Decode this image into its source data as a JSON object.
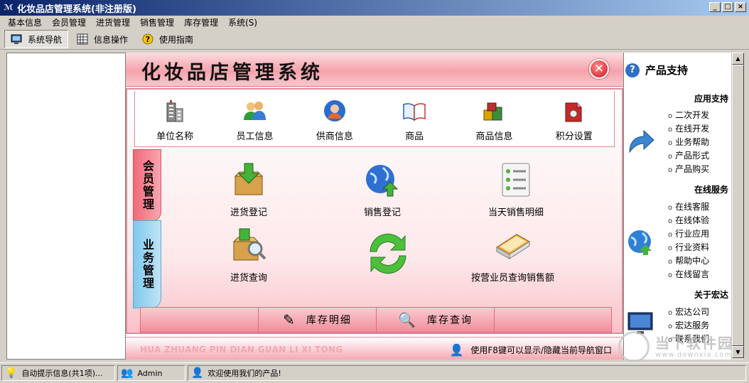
{
  "window": {
    "title": "化妆品店管理系统(非注册版)"
  },
  "menu": [
    "基本信息",
    "会员管理",
    "进货管理",
    "销售管理",
    "库存管理",
    "系统(S)"
  ],
  "toolbar": {
    "nav": "系统导航",
    "info": "信息操作",
    "guide": "使用指南"
  },
  "main": {
    "title": "化妆品店管理系统",
    "top_items": [
      "单位名称",
      "员工信息",
      "供商信息",
      "商品",
      "商品信息",
      "积分设置"
    ],
    "tabs": {
      "member": "会员管理",
      "business": "业务管理"
    },
    "actions": {
      "purchase_reg": "进货登记",
      "sales_reg": "销售登记",
      "daily_sales": "当天销售明细",
      "purchase_query": "进货查询",
      "clerk_sales": "按营业员查询销售额"
    },
    "bottom": {
      "stock_detail": "库存明细",
      "stock_query": "库存查询"
    },
    "footer_pinyin": "HUA ZHUANG PIN DIAN GUAN LI XI TONG",
    "footer_hint": "使用F8键可以显示/隐藏当前导航窗口"
  },
  "right": {
    "title": "产品支持",
    "sec1": "应用支持",
    "sec1_items": [
      "二次开发",
      "在线开发",
      "业务帮助",
      "产品形式",
      "产品购买"
    ],
    "sec2": "在线服务",
    "sec2_items": [
      "在线客服",
      "在线体验",
      "行业应用",
      "行业资料",
      "帮助中心",
      "在线留言"
    ],
    "sec3": "关于宏达",
    "sec3_items": [
      "宏达公司",
      "宏达服务",
      "联系我们"
    ]
  },
  "status": {
    "tips": "自动提示信息(共1项)...",
    "user": "Admin",
    "welcome": "欢迎使用我们的产品!"
  },
  "watermark": {
    "name": "当下软件园",
    "url": "www.downxia.com"
  }
}
